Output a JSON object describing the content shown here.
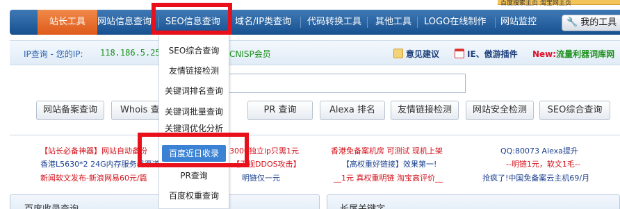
{
  "top_ad": {
    "text": "百度搜索主页 淘宝网主页"
  },
  "nav": {
    "items": [
      {
        "label": "站长工具"
      },
      {
        "label": "网站信息查询"
      },
      {
        "label": "SEO信息查询"
      },
      {
        "label": "域名/IP类查询"
      },
      {
        "label": "代码转换工具"
      },
      {
        "label": "其他工具"
      },
      {
        "label": "LOGO在线制作"
      },
      {
        "label": "网站监控"
      }
    ],
    "my_tools": "我的工具"
  },
  "info_bar": {
    "ip_label": "IP查询 - 您的IP:",
    "ip_value": "118.186.5.25",
    "cnisp": "CNISP会员",
    "suggest": "意见建议",
    "plugin": "IE、傲游插件",
    "new_label": "New:",
    "new_text": "流量利器词库网"
  },
  "dropdown": {
    "items": [
      {
        "label": "SEO综合查询"
      },
      {
        "label": "友情链接检测"
      },
      {
        "label": "关键词排名查询"
      },
      {
        "label": "关键词批量查询"
      },
      {
        "label": "关键词优化分析"
      },
      {
        "label": "百度近日收录"
      },
      {
        "label": "PR查询"
      },
      {
        "label": "百度权重查询"
      }
    ],
    "selected_index": 5
  },
  "tool_buttons": [
    {
      "label": "网站备案查询"
    },
    {
      "label": "Whois 查"
    },
    {
      "label": "PR 查询"
    },
    {
      "label": "Alexa 排名"
    },
    {
      "label": "友情链接检测"
    },
    {
      "label": "网站安全检测"
    },
    {
      "label": "SEO综合查询"
    }
  ],
  "ads": {
    "row1": [
      {
        "text": "【站长必备神器】网站自动备份"
      },
      {
        "text": "3000独立ip只需1元"
      },
      {
        "text": "香港免备案机房 可测试 现机上架"
      },
      {
        "text": "QQ:80073 Alexa提升"
      }
    ],
    "row2": [
      {
        "text": "香港L5630*2 24G内存服务器渠道"
      },
      {
        "text": "【无视DDOS攻击】"
      },
      {
        "text": "【高权重好链接】效果第一!"
      },
      {
        "text": "--明链1元，软文1毛--"
      }
    ],
    "row3": [
      {
        "text": "新闻软文发布-新浪网易60元/篇"
      },
      {
        "text": "明链仅一元"
      },
      {
        "text": "__1元 真权重明链 淘宝高评价__"
      },
      {
        "text": "抢疯了!中国免备案云主机69/月"
      }
    ]
  },
  "panels": {
    "left_title": "百度收录查询",
    "right_title": "长尾关键字"
  },
  "colors": {
    "nav_blue": "#1f5fa3",
    "nav_active_orange": "#e8702e",
    "highlight_red": "#e8101a",
    "dropdown_selected": "#3b82d4"
  }
}
